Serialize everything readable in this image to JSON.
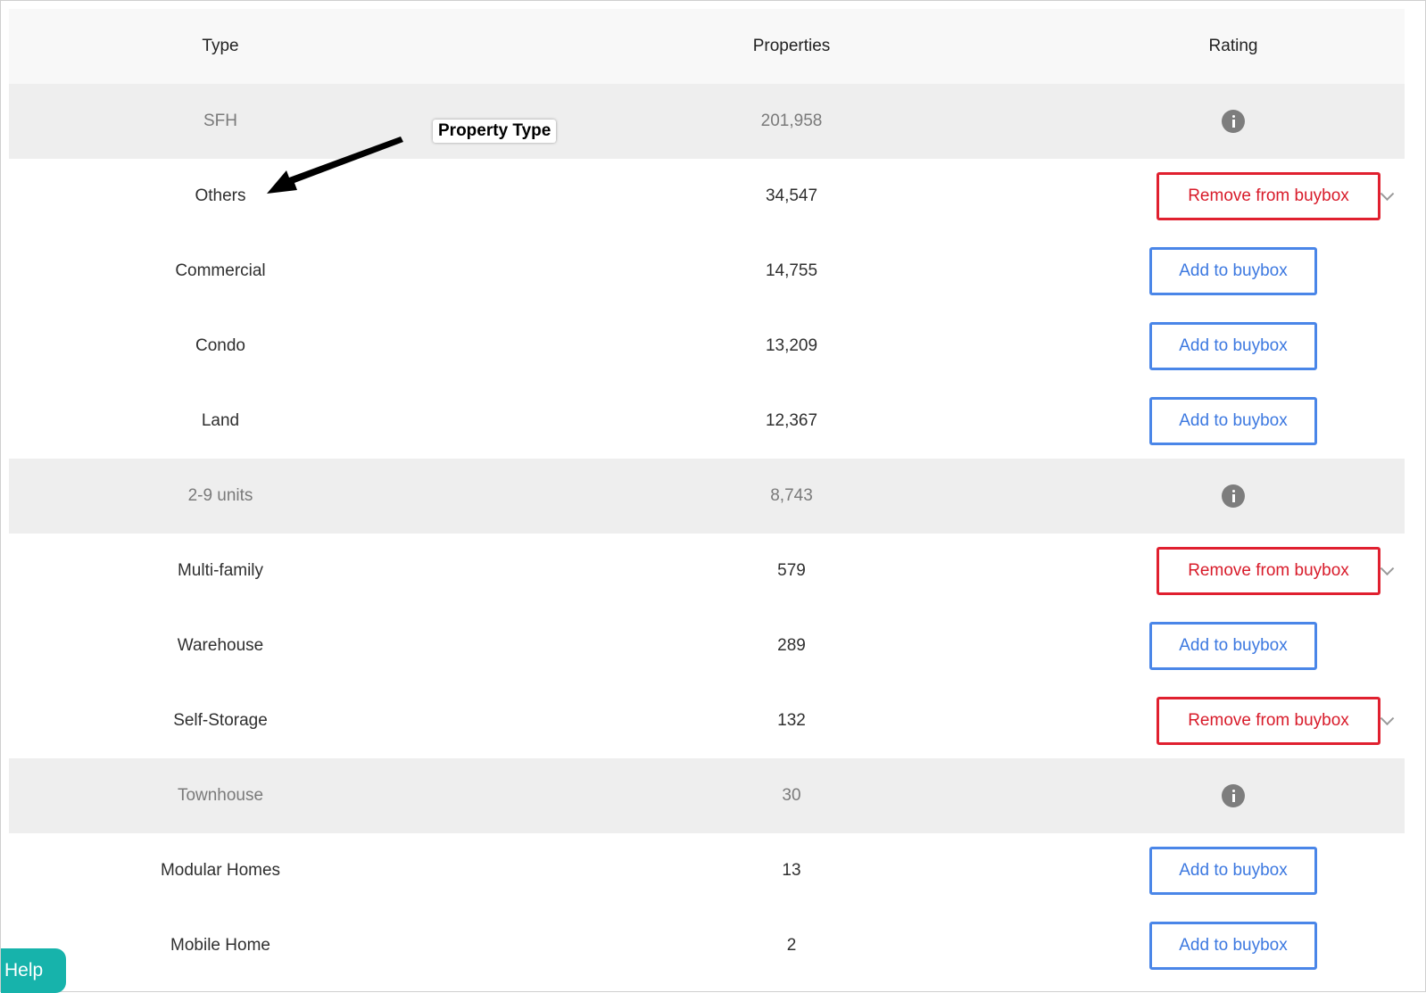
{
  "table": {
    "headers": {
      "type": "Type",
      "properties": "Properties",
      "rating": "Rating"
    },
    "rows": [
      {
        "type": "SFH",
        "properties": "201,958",
        "kind": "group",
        "rating_icon": "info-icon"
      },
      {
        "type": "Others",
        "properties": "34,547",
        "kind": "item",
        "action": "Remove from buybox"
      },
      {
        "type": "Commercial",
        "properties": "14,755",
        "kind": "item",
        "action": "Add to buybox"
      },
      {
        "type": "Condo",
        "properties": "13,209",
        "kind": "item",
        "action": "Add to buybox"
      },
      {
        "type": "Land",
        "properties": "12,367",
        "kind": "item",
        "action": "Add to buybox"
      },
      {
        "type": "2-9 units",
        "properties": "8,743",
        "kind": "group",
        "rating_icon": "info-icon"
      },
      {
        "type": "Multi-family",
        "properties": "579",
        "kind": "item",
        "action": "Remove from buybox"
      },
      {
        "type": "Warehouse",
        "properties": "289",
        "kind": "item",
        "action": "Add to buybox"
      },
      {
        "type": "Self-Storage",
        "properties": "132",
        "kind": "item",
        "action": "Remove from buybox"
      },
      {
        "type": "Townhouse",
        "properties": "30",
        "kind": "group",
        "rating_icon": "info-icon"
      },
      {
        "type": "Modular Homes",
        "properties": "13",
        "kind": "item",
        "action": "Add to buybox"
      },
      {
        "type": "Mobile Home",
        "properties": "2",
        "kind": "item",
        "action": "Add to buybox"
      }
    ]
  },
  "annotation": {
    "label": "Property Type"
  },
  "help": {
    "label": "Help"
  },
  "colors": {
    "add_button": "#4a86e8",
    "remove_button": "#e0202f",
    "group_row_bg": "#eeeeee",
    "help_bg": "#17b3ab"
  }
}
